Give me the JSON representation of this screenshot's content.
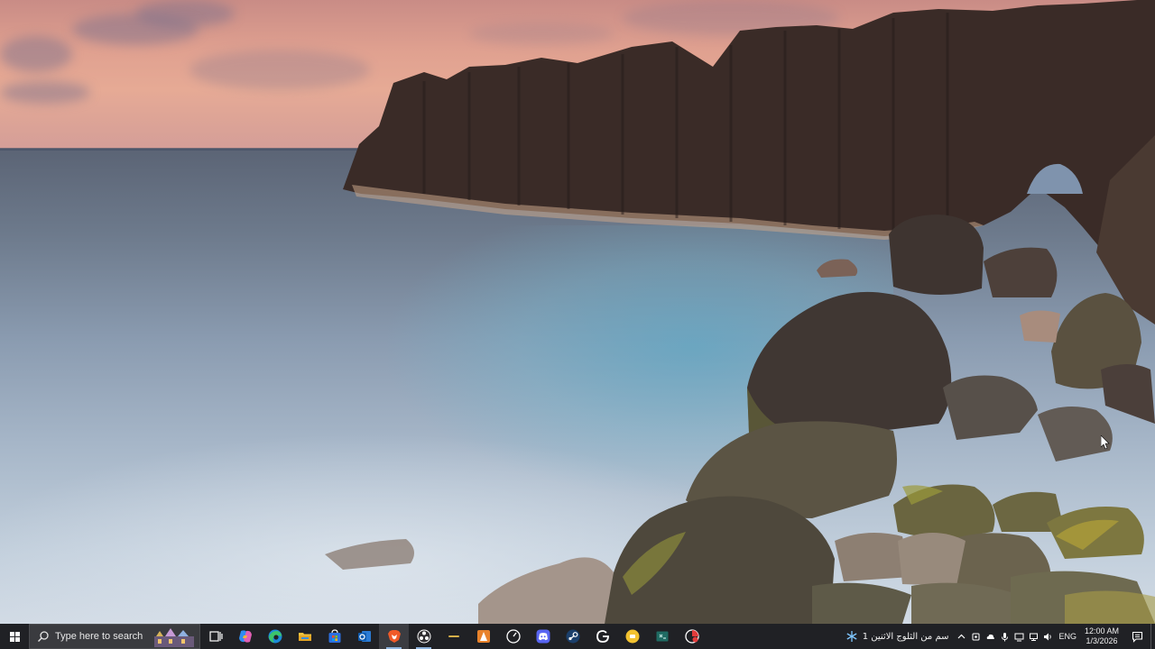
{
  "desktop": {
    "wallpaper": "volcanic sea cliffs at sunset",
    "sky_color": "#e0a190",
    "sea_color": "#8a9bb0",
    "rock_color": "#3b2b26"
  },
  "taskbar": {
    "background": "#202125",
    "start_icon": "windows-logo-icon",
    "search": {
      "placeholder": "Type here to search",
      "icon": "search-icon"
    },
    "pinned": [
      {
        "name": "task-view",
        "icon": "task-view-icon",
        "state": "idle"
      },
      {
        "name": "copilot",
        "icon": "copilot-icon",
        "state": "idle"
      },
      {
        "name": "edge",
        "icon": "edge-icon",
        "state": "idle"
      },
      {
        "name": "file-explorer",
        "icon": "folder-icon",
        "state": "idle"
      },
      {
        "name": "microsoft-store",
        "icon": "store-icon",
        "state": "idle"
      },
      {
        "name": "outlook",
        "icon": "outlook-icon",
        "state": "idle"
      },
      {
        "name": "brave",
        "icon": "brave-icon",
        "state": "active"
      },
      {
        "name": "obs",
        "icon": "obs-icon",
        "state": "running"
      },
      {
        "name": "app-generic",
        "icon": "dash-app-icon",
        "state": "idle"
      },
      {
        "name": "vlc-like",
        "icon": "cone-app-icon",
        "state": "idle"
      },
      {
        "name": "speedometer",
        "icon": "speedometer-icon",
        "state": "idle"
      },
      {
        "name": "discord",
        "icon": "discord-icon",
        "state": "idle"
      },
      {
        "name": "steam",
        "icon": "steam-icon",
        "state": "idle"
      },
      {
        "name": "g-app",
        "icon": "g-app-icon",
        "state": "idle"
      },
      {
        "name": "yellow-app",
        "icon": "yellow-circle-icon",
        "state": "idle"
      },
      {
        "name": "terminal-app",
        "icon": "terminal-icon",
        "state": "idle"
      },
      {
        "name": "red-app",
        "icon": "red-app-icon",
        "state": "idle"
      }
    ],
    "tray": {
      "weather_text": "سم من الثلوج الاثنين 1",
      "weather_icon": "snowflake-icon",
      "language": "ENG",
      "time": "12:00 AM",
      "date": "1/3/2026"
    }
  }
}
